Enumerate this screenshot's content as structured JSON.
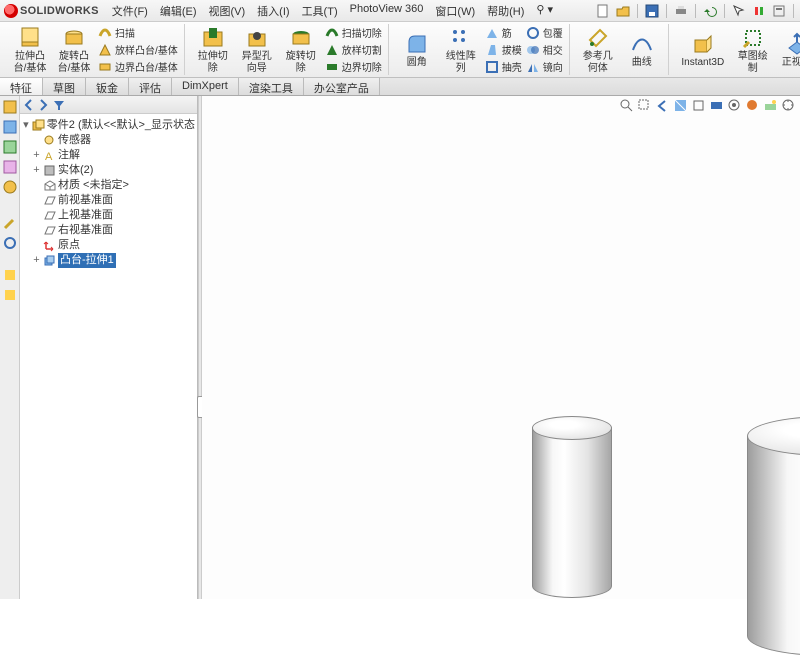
{
  "app": {
    "name": "SOLIDWORKS"
  },
  "menus": [
    {
      "label": "文件(F)"
    },
    {
      "label": "编辑(E)"
    },
    {
      "label": "视图(V)"
    },
    {
      "label": "插入(I)"
    },
    {
      "label": "工具(T)"
    },
    {
      "label": "PhotoView 360"
    },
    {
      "label": "窗口(W)"
    },
    {
      "label": "帮助(H)"
    }
  ],
  "ribbon": {
    "big": [
      {
        "l1": "拉伸凸",
        "l2": "台/基体"
      },
      {
        "l1": "旋转凸",
        "l2": "台/基体"
      }
    ],
    "col1": [
      {
        "label": "扫描"
      },
      {
        "label": "放样凸台/基体"
      },
      {
        "label": "边界凸台/基体"
      }
    ],
    "big2": [
      {
        "l1": "拉伸切",
        "l2": "除"
      },
      {
        "l1": "异型孔",
        "l2": "向导"
      },
      {
        "l1": "旋转切",
        "l2": "除"
      }
    ],
    "col2": [
      {
        "label": "扫描切除"
      },
      {
        "label": "放样切割"
      },
      {
        "label": "边界切除"
      }
    ],
    "big3": [
      {
        "l1": "圆角",
        "l2": ""
      },
      {
        "l1": "线性阵",
        "l2": "列"
      }
    ],
    "col3": [
      {
        "label": "筋"
      },
      {
        "label": "拔模"
      },
      {
        "label": "抽壳"
      }
    ],
    "col4": [
      {
        "label": "包覆"
      },
      {
        "label": "相交"
      },
      {
        "label": "镜向"
      }
    ],
    "big4": [
      {
        "l1": "参考几",
        "l2": "何体"
      },
      {
        "l1": "曲线",
        "l2": ""
      }
    ],
    "big5": [
      {
        "l1": "Instant3D",
        "l2": ""
      },
      {
        "l1": "草图绘",
        "l2": "制"
      },
      {
        "l1": "正视于",
        "l2": ""
      }
    ]
  },
  "tabs": [
    {
      "label": "特征",
      "active": true
    },
    {
      "label": "草图"
    },
    {
      "label": "钣金"
    },
    {
      "label": "评估"
    },
    {
      "label": "DimXpert"
    },
    {
      "label": "渲染工具"
    },
    {
      "label": "办公室产品"
    }
  ],
  "tree": {
    "root": "零件2 (默认<<默认>_显示状态",
    "items": [
      {
        "label": "传感器",
        "ic": "sensor"
      },
      {
        "label": "注解",
        "ic": "annot",
        "exp": "+"
      },
      {
        "label": "实体(2)",
        "ic": "solid",
        "exp": "+"
      },
      {
        "label": "材质 <未指定>",
        "ic": "mat"
      },
      {
        "label": "前视基准面",
        "ic": "plane"
      },
      {
        "label": "上视基准面",
        "ic": "plane"
      },
      {
        "label": "右视基准面",
        "ic": "plane"
      },
      {
        "label": "原点",
        "ic": "origin"
      },
      {
        "label": "凸台-拉伸1",
        "ic": "ext",
        "exp": "+",
        "sel": true
      }
    ]
  },
  "colors": {
    "selBg": "#2f6fb5"
  }
}
